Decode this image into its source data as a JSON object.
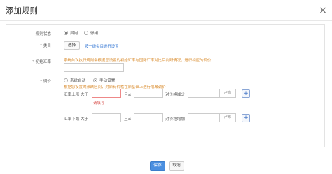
{
  "dialog": {
    "title": "添加规则",
    "close": "×"
  },
  "form": {
    "rule_status": {
      "label": "规则状态",
      "options": [
        "启用",
        "停用"
      ],
      "selected": "启用"
    },
    "category": {
      "label": "* 类目",
      "button": "选择",
      "hint": "按一级类目进行设置"
    },
    "initial_rate": {
      "label": "* 初始汇率",
      "hint": "系统首次执行规则会根据您设置的初始汇率与国际汇率对比后判断情况，进行相应的调价"
    },
    "pricing": {
      "label": "* 调价",
      "options": [
        "系统自动",
        "手动设置"
      ],
      "selected": "手动设置",
      "hint": "根据您设置的涨跌区间，对原有价格在原基础上进行增减调价",
      "rise": {
        "label": "汇率上涨",
        "greater_than": "大于",
        "and": "且≤",
        "action": "对价格减少",
        "suffix": "卢布",
        "error": "请填写"
      },
      "fall": {
        "label": "汇率下跌",
        "greater_than": "大于",
        "and": "且≤",
        "action": "对价格增加",
        "suffix": "卢布"
      },
      "add": "+"
    }
  },
  "footer": {
    "save": "保存",
    "cancel": "取消"
  }
}
